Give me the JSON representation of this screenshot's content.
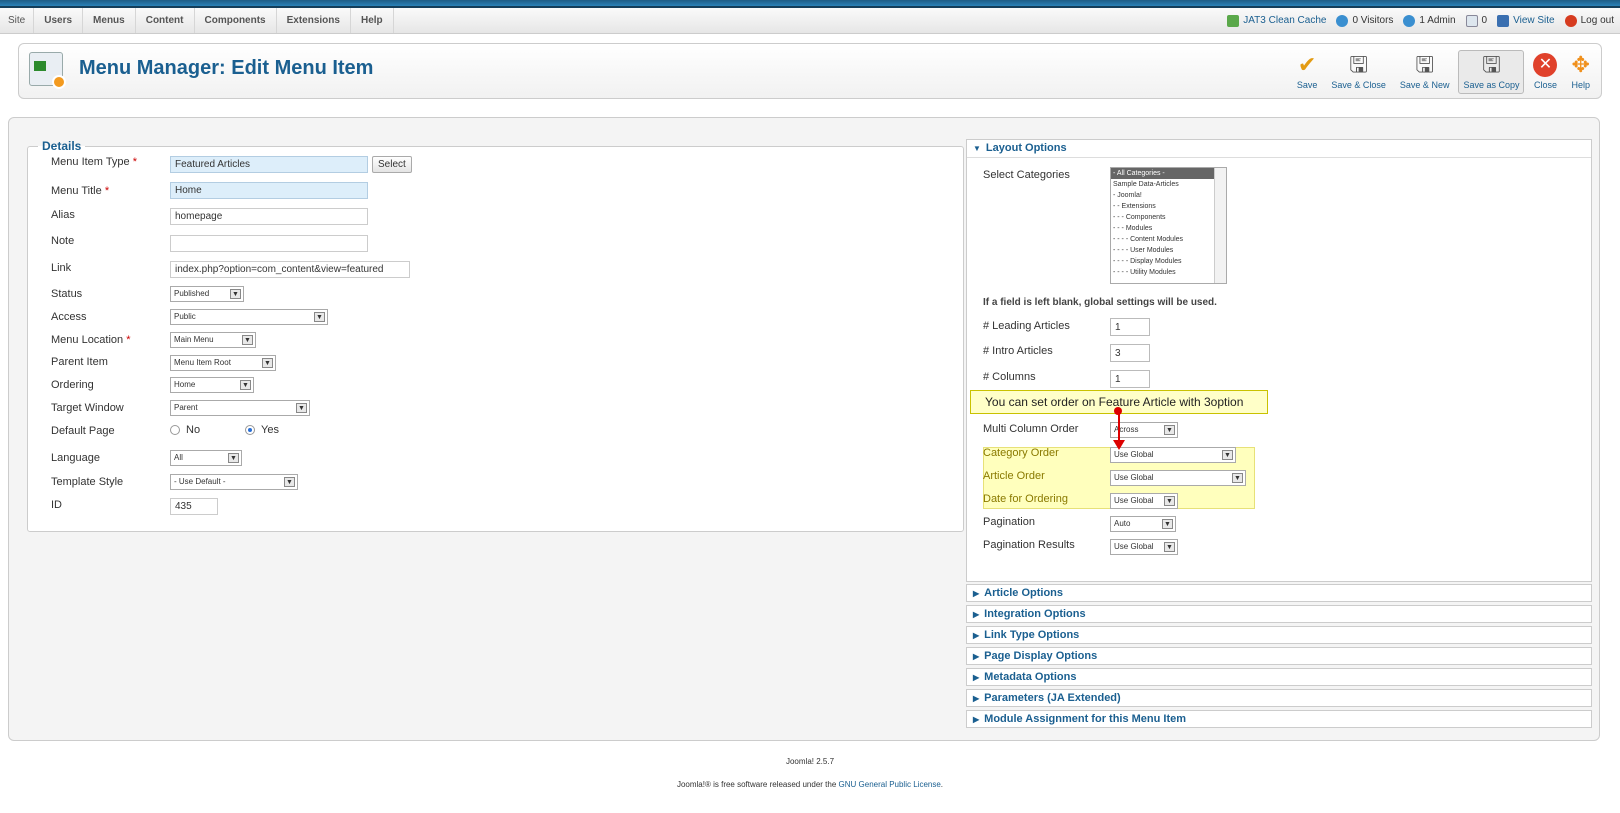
{
  "menubar": {
    "items": [
      "Site",
      "Users",
      "Menus",
      "Content",
      "Components",
      "Extensions",
      "Help"
    ],
    "status": {
      "cache": "JAT3 Clean Cache",
      "visitors": "0 Visitors",
      "admin": "1 Admin",
      "messages": "0",
      "view_site": "View Site",
      "logout": "Log out"
    }
  },
  "toolbar": {
    "title": "Menu Manager: Edit Menu Item",
    "save": "Save",
    "save_close": "Save & Close",
    "save_new": "Save & New",
    "save_copy": "Save as Copy",
    "close": "Close",
    "help": "Help"
  },
  "details": {
    "legend": "Details",
    "menu_item_type_label": "Menu Item Type",
    "menu_item_type_value": "Featured Articles",
    "select_button": "Select",
    "menu_title_label": "Menu Title",
    "menu_title_value": "Home",
    "alias_label": "Alias",
    "alias_value": "homepage",
    "note_label": "Note",
    "note_value": "",
    "link_label": "Link",
    "link_value": "index.php?option=com_content&view=featured",
    "status_label": "Status",
    "status_value": "Published",
    "access_label": "Access",
    "access_value": "Public",
    "menu_location_label": "Menu Location",
    "menu_location_value": "Main Menu",
    "parent_item_label": "Parent Item",
    "parent_item_value": "Menu Item Root",
    "ordering_label": "Ordering",
    "ordering_value": "Home",
    "target_window_label": "Target Window",
    "target_window_value": "Parent",
    "default_page_label": "Default Page",
    "default_no": "No",
    "default_yes": "Yes",
    "language_label": "Language",
    "language_value": "All",
    "template_style_label": "Template Style",
    "template_style_value": "- Use Default -",
    "id_label": "ID",
    "id_value": "435",
    "required_mark": "*"
  },
  "layout": {
    "header": "Layout Options",
    "select_categories_label": "Select Categories",
    "categories": [
      "- All Categories -",
      "Sample Data-Articles",
      "- Joomla!",
      "- - Extensions",
      "- - - Components",
      "- - - Modules",
      "- - - - Content Modules",
      "- - - - User Modules",
      "- - - - Display Modules",
      "- - - - Utility Modules"
    ],
    "blank_note": "If a field is left blank, global settings will be used.",
    "leading_label": "# Leading Articles",
    "leading_value": "1",
    "intro_label": "# Intro Articles",
    "intro_value": "3",
    "columns_label": "# Columns",
    "columns_value": "1",
    "multi_column_label": "Multi Column Order",
    "multi_column_value": "Across",
    "category_order_label": "Category Order",
    "category_order_value": "Use Global",
    "article_order_label": "Article Order",
    "article_order_value": "Use Global",
    "date_ordering_label": "Date for Ordering",
    "date_ordering_value": "Use Global",
    "pagination_label": "Pagination",
    "pagination_value": "Auto",
    "pagination_results_label": "Pagination Results",
    "pagination_results_value": "Use Global"
  },
  "callout": "You can set order on Feature Article with 3option",
  "accordion": [
    "Article Options",
    "Integration Options",
    "Link Type Options",
    "Page Display Options",
    "Metadata Options",
    "Parameters (JA Extended)",
    "Module Assignment for this Menu Item"
  ],
  "footer": {
    "version": "Joomla! 2.5.7",
    "license_pre": "Joomla!® is free software released under the",
    "license_link": "GNU General Public License",
    "license_post": "."
  }
}
